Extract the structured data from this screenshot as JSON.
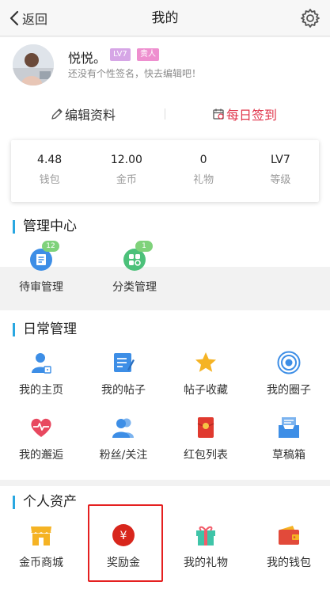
{
  "nav": {
    "back_label": "返回",
    "title": "我的"
  },
  "profile": {
    "name": "悦悦。",
    "level_badge": "LV7",
    "vip_badge": "贵人",
    "signature": "还没有个性签名，快去编辑吧！",
    "edit_label": "编辑资料",
    "sign_label": "每日签到"
  },
  "stats": [
    {
      "value": "4.48",
      "label": "钱包"
    },
    {
      "value": "12.00",
      "label": "金币"
    },
    {
      "value": "0",
      "label": "礼物"
    },
    {
      "value": "LV7",
      "label": "等级"
    }
  ],
  "management": {
    "title": "管理中心",
    "items": [
      {
        "label": "待审管理",
        "count": "12",
        "icon": "review-doc-icon"
      },
      {
        "label": "分类管理",
        "count": "1",
        "icon": "category-icon"
      }
    ]
  },
  "daily": {
    "title": "日常管理",
    "items": [
      {
        "label": "我的主页",
        "icon": "user-home-icon"
      },
      {
        "label": "我的帖子",
        "icon": "post-edit-icon"
      },
      {
        "label": "帖子收藏",
        "icon": "star-icon"
      },
      {
        "label": "我的圈子",
        "icon": "circle-target-icon"
      },
      {
        "label": "我的邂逅",
        "icon": "heart-pulse-icon"
      },
      {
        "label": "粉丝/关注",
        "icon": "fans-icon"
      },
      {
        "label": "红包列表",
        "icon": "red-packet-icon"
      },
      {
        "label": "草稿箱",
        "icon": "drafts-tray-icon"
      }
    ]
  },
  "assets": {
    "title": "个人资产",
    "items": [
      {
        "label": "金币商城",
        "icon": "shop-icon"
      },
      {
        "label": "奖励金",
        "icon": "reward-yen-icon",
        "glyph": "¥"
      },
      {
        "label": "我的礼物",
        "icon": "gift-icon"
      },
      {
        "label": "我的钱包",
        "icon": "wallet-icon"
      }
    ]
  },
  "colors": {
    "accent_blue": "#29a7e1",
    "sign_red": "#e0354b",
    "badge_green": "#7fd27b",
    "highlight_red": "#e52020"
  }
}
